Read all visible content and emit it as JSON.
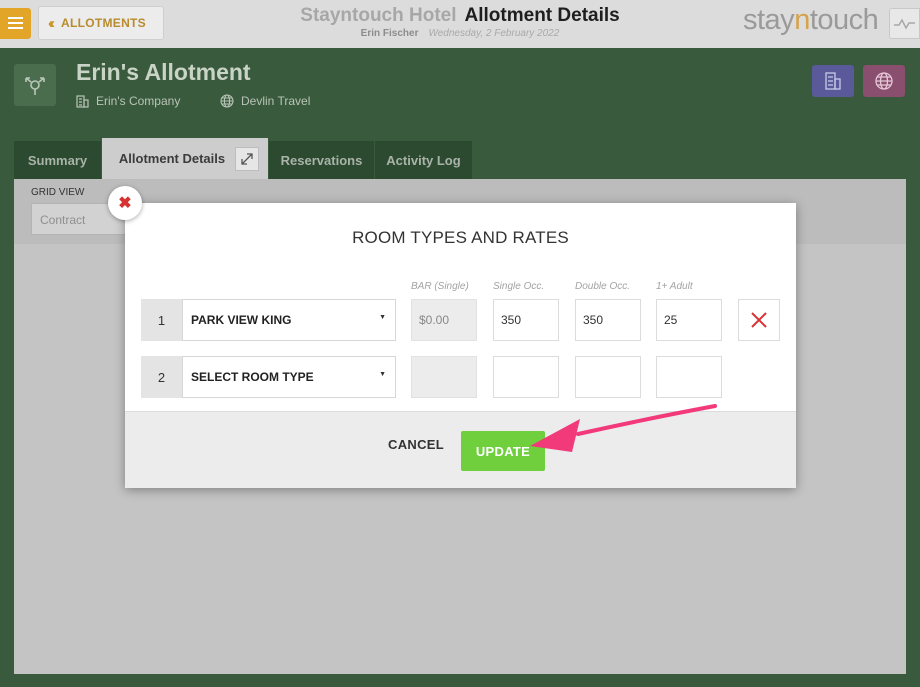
{
  "header": {
    "back_label": "ALLOTMENTS",
    "hotel_name": "Stayntouch Hotel",
    "page_title": "Allotment Details",
    "user_name": "Erin Fischer",
    "business_date": "Wednesday, 2 February 2022",
    "logo_text_a": "stay",
    "logo_text_n": "n",
    "logo_text_b": "touch"
  },
  "allotment": {
    "title": "Erin's Allotment",
    "company": "Erin's Company",
    "travel_agent": "Devlin Travel"
  },
  "tabs": [
    {
      "label": "Summary"
    },
    {
      "label": "Allotment Details"
    },
    {
      "label": "Reservations"
    },
    {
      "label": "Activity Log"
    }
  ],
  "grid": {
    "label": "GRID VIEW",
    "selected": "Contract"
  },
  "modal": {
    "title": "ROOM TYPES AND RATES",
    "columns": [
      "BAR (Single)",
      "Single Occ.",
      "Double Occ.",
      "1+ Adult"
    ],
    "rows": [
      {
        "num": "1",
        "room_type": "PARK VIEW KING",
        "bar": "$0.00",
        "single": "350",
        "double": "350",
        "extra_adult": "25"
      },
      {
        "num": "2",
        "room_type": "SELECT ROOM TYPE",
        "bar": "",
        "single": "",
        "double": "",
        "extra_adult": ""
      }
    ],
    "cancel_label": "CANCEL",
    "update_label": "UPDATE"
  },
  "colors": {
    "accent_gold": "#e3a528",
    "update_green": "#6fcf3c",
    "annotation_pink": "#f23a7a",
    "delete_red": "#d73232"
  }
}
